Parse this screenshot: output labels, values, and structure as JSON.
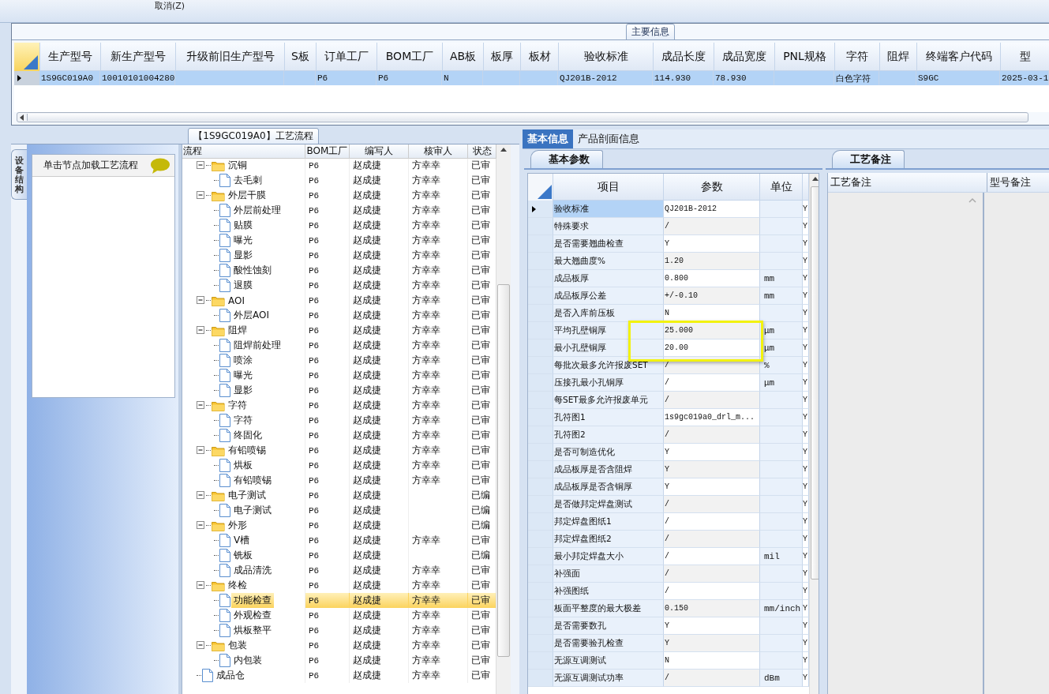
{
  "toolbar": {
    "buttons": [
      "取消(Z)"
    ]
  },
  "main_info": {
    "title": "主要信息",
    "columns": [
      "生产型号",
      "新生产型号",
      "升级前旧生产型号",
      "S板",
      "订单工厂",
      "BOM工厂",
      "AB板",
      "板厚",
      "板材",
      "验收标准",
      "成品长度",
      "成品宽度",
      "PNL规格",
      "字符",
      "阻焊",
      "终端客户代码",
      "型"
    ],
    "rows": [
      {
        "selected": true,
        "cells": [
          "1S9GC019A0",
          "10010101004280",
          "",
          "",
          "P6",
          "P6",
          "N",
          "",
          "",
          "QJ201B-2012",
          "114.930",
          "78.930",
          "",
          "白色字符",
          "",
          "S9GC",
          "2025-03-1"
        ]
      }
    ]
  },
  "process": {
    "title": "【1S9GC019A0】工艺流程",
    "side_tab": "设备结构",
    "hint": "单击节点加载工艺流程",
    "columns": [
      "流程",
      "BOM工厂",
      "编写人",
      "核审人",
      "状态"
    ],
    "rows": [
      {
        "name": "沉铜",
        "bom": "P6",
        "writer": "赵成捷",
        "reviewer": "方幸幸",
        "status": "已审",
        "selected": false,
        "children": [
          {
            "name": "去毛刺",
            "bom": "P6",
            "writer": "赵成捷",
            "reviewer": "方幸幸",
            "status": "已审",
            "selected": false
          }
        ]
      },
      {
        "name": "外层干膜",
        "bom": "P6",
        "writer": "赵成捷",
        "reviewer": "方幸幸",
        "status": "已审",
        "selected": false,
        "children": [
          {
            "name": "外层前处理",
            "bom": "P6",
            "writer": "赵成捷",
            "reviewer": "方幸幸",
            "status": "已审",
            "selected": false
          },
          {
            "name": "贴膜",
            "bom": "P6",
            "writer": "赵成捷",
            "reviewer": "方幸幸",
            "status": "已审",
            "selected": false
          },
          {
            "name": "曝光",
            "bom": "P6",
            "writer": "赵成捷",
            "reviewer": "方幸幸",
            "status": "已审",
            "selected": false
          },
          {
            "name": "显影",
            "bom": "P6",
            "writer": "赵成捷",
            "reviewer": "方幸幸",
            "status": "已审",
            "selected": false
          },
          {
            "name": "酸性蚀刻",
            "bom": "P6",
            "writer": "赵成捷",
            "reviewer": "方幸幸",
            "status": "已审",
            "selected": false
          },
          {
            "name": "退膜",
            "bom": "P6",
            "writer": "赵成捷",
            "reviewer": "方幸幸",
            "status": "已审",
            "selected": false
          }
        ]
      },
      {
        "name": "AOI",
        "bom": "P6",
        "writer": "赵成捷",
        "reviewer": "方幸幸",
        "status": "已审",
        "selected": false,
        "children": [
          {
            "name": "外层AOI",
            "bom": "P6",
            "writer": "赵成捷",
            "reviewer": "方幸幸",
            "status": "已审",
            "selected": false
          }
        ]
      },
      {
        "name": "阻焊",
        "bom": "P6",
        "writer": "赵成捷",
        "reviewer": "方幸幸",
        "status": "已审",
        "selected": false,
        "children": [
          {
            "name": "阻焊前处理",
            "bom": "P6",
            "writer": "赵成捷",
            "reviewer": "方幸幸",
            "status": "已审",
            "selected": false
          },
          {
            "name": "喷涂",
            "bom": "P6",
            "writer": "赵成捷",
            "reviewer": "方幸幸",
            "status": "已审",
            "selected": false
          },
          {
            "name": "曝光",
            "bom": "P6",
            "writer": "赵成捷",
            "reviewer": "方幸幸",
            "status": "已审",
            "selected": false
          },
          {
            "name": "显影",
            "bom": "P6",
            "writer": "赵成捷",
            "reviewer": "方幸幸",
            "status": "已审",
            "selected": false
          }
        ]
      },
      {
        "name": "字符",
        "bom": "P6",
        "writer": "赵成捷",
        "reviewer": "方幸幸",
        "status": "已审",
        "selected": false,
        "children": [
          {
            "name": "字符",
            "bom": "P6",
            "writer": "赵成捷",
            "reviewer": "方幸幸",
            "status": "已审",
            "selected": false
          },
          {
            "name": "终固化",
            "bom": "P6",
            "writer": "赵成捷",
            "reviewer": "方幸幸",
            "status": "已审",
            "selected": false
          }
        ]
      },
      {
        "name": "有铅喷锡",
        "bom": "P6",
        "writer": "赵成捷",
        "reviewer": "方幸幸",
        "status": "已审",
        "selected": false,
        "children": [
          {
            "name": "烘板",
            "bom": "P6",
            "writer": "赵成捷",
            "reviewer": "方幸幸",
            "status": "已审",
            "selected": false
          },
          {
            "name": "有铅喷锡",
            "bom": "P6",
            "writer": "赵成捷",
            "reviewer": "方幸幸",
            "status": "已审",
            "selected": false
          }
        ]
      },
      {
        "name": "电子测试",
        "bom": "P6",
        "writer": "赵成捷",
        "status": "已编",
        "selected": false,
        "children": [
          {
            "name": "电子测试",
            "bom": "P6",
            "writer": "赵成捷",
            "status": "已编",
            "selected": false
          }
        ]
      },
      {
        "name": "外形",
        "bom": "P6",
        "writer": "赵成捷",
        "status": "已编",
        "selected": false,
        "children": [
          {
            "name": "V槽",
            "bom": "P6",
            "writer": "赵成捷",
            "reviewer": "方幸幸",
            "status": "已审",
            "selected": false
          },
          {
            "name": "铣板",
            "bom": "P6",
            "writer": "赵成捷",
            "status": "已编",
            "selected": false
          },
          {
            "name": "成品清洗",
            "bom": "P6",
            "writer": "赵成捷",
            "reviewer": "方幸幸",
            "status": "已审",
            "selected": false
          }
        ]
      },
      {
        "name": "终检",
        "bom": "P6",
        "writer": "赵成捷",
        "reviewer": "方幸幸",
        "status": "已审",
        "selected": false,
        "children": [
          {
            "name": "功能检查",
            "bom": "P6",
            "writer": "赵成捷",
            "reviewer": "方幸幸",
            "status": "已审",
            "selected": true
          },
          {
            "name": "外观检查",
            "bom": "P6",
            "writer": "赵成捷",
            "reviewer": "方幸幸",
            "status": "已审",
            "selected": false
          },
          {
            "name": "烘板整平",
            "bom": "P6",
            "writer": "赵成捷",
            "reviewer": "方幸幸",
            "status": "已审",
            "selected": false
          }
        ]
      },
      {
        "name": "包装",
        "bom": "P6",
        "writer": "赵成捷",
        "reviewer": "方幸幸",
        "status": "已审",
        "selected": false,
        "children": [
          {
            "name": "内包装",
            "bom": "P6",
            "writer": "赵成捷",
            "reviewer": "方幸幸",
            "status": "已审",
            "selected": false
          }
        ]
      },
      {
        "name": "成品仓",
        "bom": "P6",
        "writer": "赵成捷",
        "reviewer": "方幸幸",
        "status": "已审",
        "selected": false
      }
    ]
  },
  "detail_tabs": [
    {
      "label": "基本信息",
      "selected": true
    },
    {
      "label": "产品剖面信息",
      "selected": false
    }
  ],
  "basic_params": {
    "tab": "基本参数",
    "columns": [
      "项目",
      "参数",
      "单位"
    ],
    "rows": [
      {
        "item": "验收标准",
        "value": "QJ201B-2012",
        "unit": "",
        "column_4": "Y",
        "selected": true,
        "highlighted": false
      },
      {
        "item": "特殊要求",
        "value": "/",
        "unit": "",
        "column_4": "Y",
        "selected": false,
        "highlighted": false
      },
      {
        "item": "是否需要翘曲检查",
        "value": "Y",
        "unit": "",
        "column_4": "Y",
        "selected": false,
        "highlighted": false
      },
      {
        "item": "最大翘曲度%",
        "value": "1.20",
        "unit": "",
        "column_4": "Y",
        "selected": false,
        "highlighted": false
      },
      {
        "item": "成品板厚",
        "value": "0.800",
        "unit": "mm",
        "column_4": "Y",
        "selected": false,
        "highlighted": false
      },
      {
        "item": "成品板厚公差",
        "value": "+/-0.10",
        "unit": "mm",
        "column_4": "Y",
        "selected": false,
        "highlighted": false
      },
      {
        "item": "是否入库前压板",
        "value": "N",
        "unit": "",
        "column_4": "Y",
        "selected": false,
        "highlighted": false
      },
      {
        "item": "平均孔壁铜厚",
        "value": "25.000",
        "unit": "μm",
        "column_4": "Y",
        "selected": false,
        "highlighted": true
      },
      {
        "item": "最小孔壁铜厚",
        "value": "20.00",
        "unit": "μm",
        "column_4": "Y",
        "selected": false,
        "highlighted": true
      },
      {
        "item": "每批次最多允许报废SET",
        "value": "/",
        "unit": "%",
        "column_4": "Y",
        "selected": false,
        "highlighted": false
      },
      {
        "item": "压接孔最小孔铜厚",
        "value": "/",
        "unit": "μm",
        "column_4": "Y",
        "selected": false,
        "highlighted": false
      },
      {
        "item": "每SET最多允许报废单元",
        "value": "/",
        "unit": "",
        "column_4": "Y",
        "selected": false,
        "highlighted": false
      },
      {
        "item": "孔符图1",
        "value": "1s9gc019a0_drl_m...",
        "unit": "",
        "column_4": "Y",
        "selected": false,
        "highlighted": false
      },
      {
        "item": "孔符图2",
        "value": "/",
        "unit": "",
        "column_4": "Y",
        "selected": false,
        "highlighted": false
      },
      {
        "item": "是否可制造优化",
        "value": "Y",
        "unit": "",
        "column_4": "Y",
        "selected": false,
        "highlighted": false
      },
      {
        "item": "成品板厚是否含阻焊",
        "value": "Y",
        "unit": "",
        "column_4": "Y",
        "selected": false,
        "highlighted": false
      },
      {
        "item": "成品板厚是否含铜厚",
        "value": "Y",
        "unit": "",
        "column_4": "Y",
        "selected": false,
        "highlighted": false
      },
      {
        "item": "是否做邦定焊盘测试",
        "value": "/",
        "unit": "",
        "column_4": "Y",
        "selected": false,
        "highlighted": false
      },
      {
        "item": "邦定焊盘图纸1",
        "value": "/",
        "unit": "",
        "column_4": "Y",
        "selected": false,
        "highlighted": false
      },
      {
        "item": "邦定焊盘图纸2",
        "value": "/",
        "unit": "",
        "column_4": "Y",
        "selected": false,
        "highlighted": false
      },
      {
        "item": "最小邦定焊盘大小",
        "value": "/",
        "unit": "mil",
        "column_4": "Y",
        "selected": false,
        "highlighted": false
      },
      {
        "item": "补强面",
        "value": "/",
        "unit": "",
        "column_4": "Y",
        "selected": false,
        "highlighted": false
      },
      {
        "item": "补强图纸",
        "value": "/",
        "unit": "",
        "column_4": "Y",
        "selected": false,
        "highlighted": false
      },
      {
        "item": "板面平整度的最大极差",
        "value": "0.150",
        "unit": "mm/inch",
        "column_4": "Y",
        "selected": false,
        "highlighted": false
      },
      {
        "item": "是否需要数孔",
        "value": "Y",
        "unit": "",
        "column_4": "Y",
        "selected": false,
        "highlighted": false
      },
      {
        "item": "是否需要验孔检查",
        "value": "Y",
        "unit": "",
        "column_4": "Y",
        "selected": false,
        "highlighted": false
      },
      {
        "item": "无源互调测试",
        "value": "N",
        "unit": "",
        "column_4": "Y",
        "selected": false,
        "highlighted": false
      },
      {
        "item": "无源互调测试功率",
        "value": "/",
        "unit": "dBm",
        "column_4": "Y",
        "selected": false,
        "highlighted": false
      }
    ]
  },
  "process_notes": {
    "tab": "工艺备注",
    "columns": [
      "工艺备注",
      "型号备注"
    ]
  }
}
